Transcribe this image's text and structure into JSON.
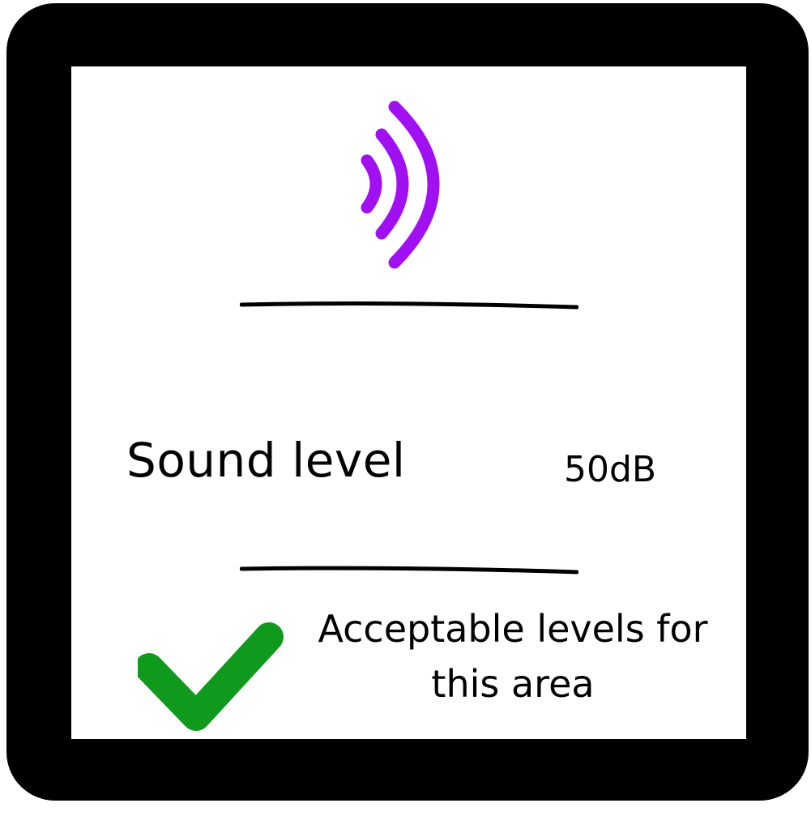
{
  "screen": {
    "icon": "sound-waves-icon",
    "sound": {
      "label": "Sound level",
      "value": "50dB"
    },
    "status": {
      "icon": "checkmark-icon",
      "text": "Acceptable levels for this area"
    }
  },
  "colors": {
    "frame": "#000000",
    "screen_background": "#ffffff",
    "sound_icon": "#a010f2",
    "check_icon": "#0f9a1d",
    "text": "#000000"
  }
}
